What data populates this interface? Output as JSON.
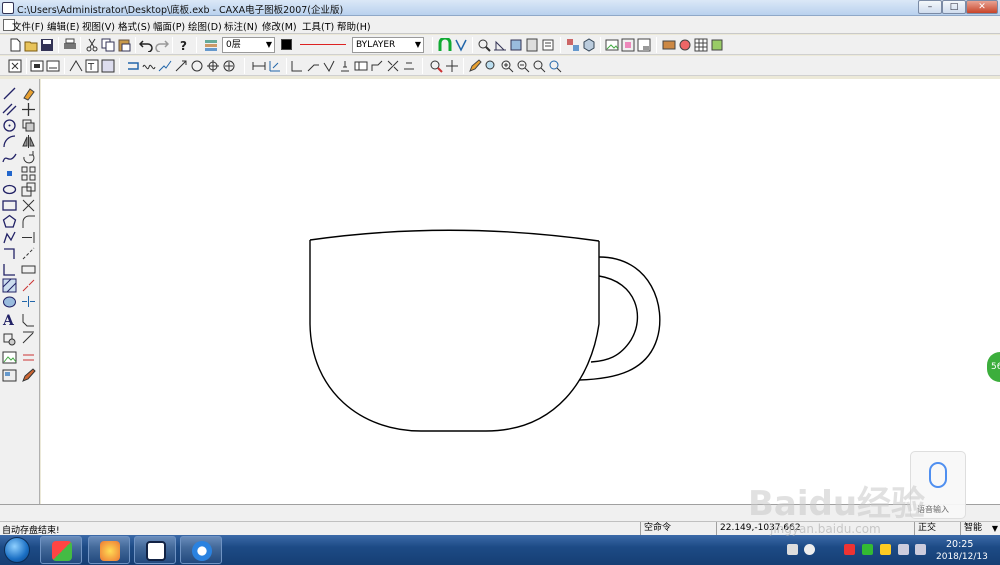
{
  "window": {
    "title": "C:\\Users\\Administrator\\Desktop\\底板.exb - CAXA电子图板2007(企业版)",
    "minimize": "–",
    "maximize": "□",
    "close": "✕"
  },
  "menu": [
    {
      "label": "文件(F)",
      "name": "menu-file"
    },
    {
      "label": "编辑(E)",
      "name": "menu-edit"
    },
    {
      "label": "视图(V)",
      "name": "menu-view"
    },
    {
      "label": "格式(S)",
      "name": "menu-format"
    },
    {
      "label": "幅面(P)",
      "name": "menu-sheet"
    },
    {
      "label": "绘图(D)",
      "name": "menu-draw"
    },
    {
      "label": "标注(N)",
      "name": "menu-dimension"
    },
    {
      "label": "修改(M)",
      "name": "menu-modify"
    },
    {
      "label": "工具(T)",
      "name": "menu-tools"
    },
    {
      "label": "帮助(H)",
      "name": "menu-help"
    }
  ],
  "toolbar": {
    "layer_value": "0层",
    "linetype_value": "BYLAYER"
  },
  "status": {
    "message": "自动存盘结束!",
    "command": "空命令",
    "coordinates": "22.149,-1037.662",
    "mode_left": "正交",
    "mode_right": "智能"
  },
  "taskbar": {
    "time": "20:25",
    "date": "2018/12/13"
  },
  "overlay": {
    "badge": "56",
    "voice_label": "语音输入",
    "watermark": "Baidu经验",
    "watermark_url": "jingyan.baidu.com"
  },
  "colors": {
    "layer_color": "#000000",
    "line_preview": "#dd2222",
    "canvas": "#ffffff",
    "taskbar": "#1d4b86"
  },
  "icons": {
    "toolbar_row1": [
      "new-file-icon",
      "open-icon",
      "save-icon",
      "print-icon",
      "cut-icon",
      "copy-icon",
      "paste-icon",
      "undo-icon",
      "redo-icon",
      "help-pointer-icon",
      "layer-icon"
    ],
    "left_column": [
      "line-icon",
      "parallel-line-icon",
      "circle-icon",
      "arc-icon",
      "spline-icon",
      "point-icon",
      "ellipse-icon",
      "rectangle-icon",
      "polygon-icon",
      "polyline-icon",
      "centerline-icon",
      "equidistant-icon",
      "hatch-icon",
      "fill-icon",
      "text-icon"
    ]
  }
}
